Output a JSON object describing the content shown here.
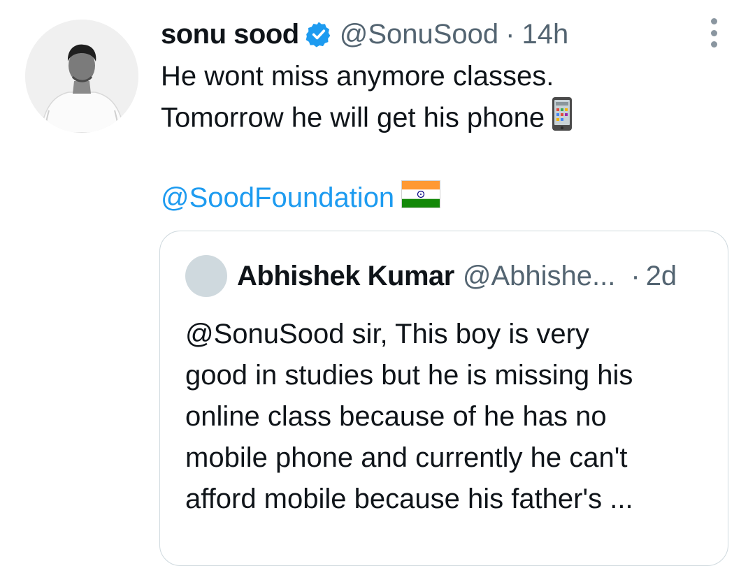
{
  "tweet": {
    "display_name": "sonu sood",
    "handle": "@SonuSood",
    "separator": "·",
    "time": "14h",
    "line1": "He wont miss anymore classes.",
    "line2": "Tomorrow he will get his phone",
    "mention": "@SoodFoundation",
    "icons": {
      "verified": "verified-badge-icon",
      "phone": "mobile-phone-emoji",
      "flag": "india-flag-emoji",
      "more": "more-options-icon"
    },
    "colors": {
      "accent": "#1d9bf0",
      "text": "#0f1419",
      "secondary": "#536471",
      "border": "#cfd9de"
    }
  },
  "quoted": {
    "display_name": "Abhishek Kumar",
    "handle": "@Abhishe...",
    "separator": "·",
    "time": "2d",
    "lines": [
      "@SonuSood sir, This boy is very",
      "good in studies but he is missing his",
      "online class because of he has no",
      "mobile phone and currently he can't",
      "afford mobile because his father's ..."
    ]
  }
}
